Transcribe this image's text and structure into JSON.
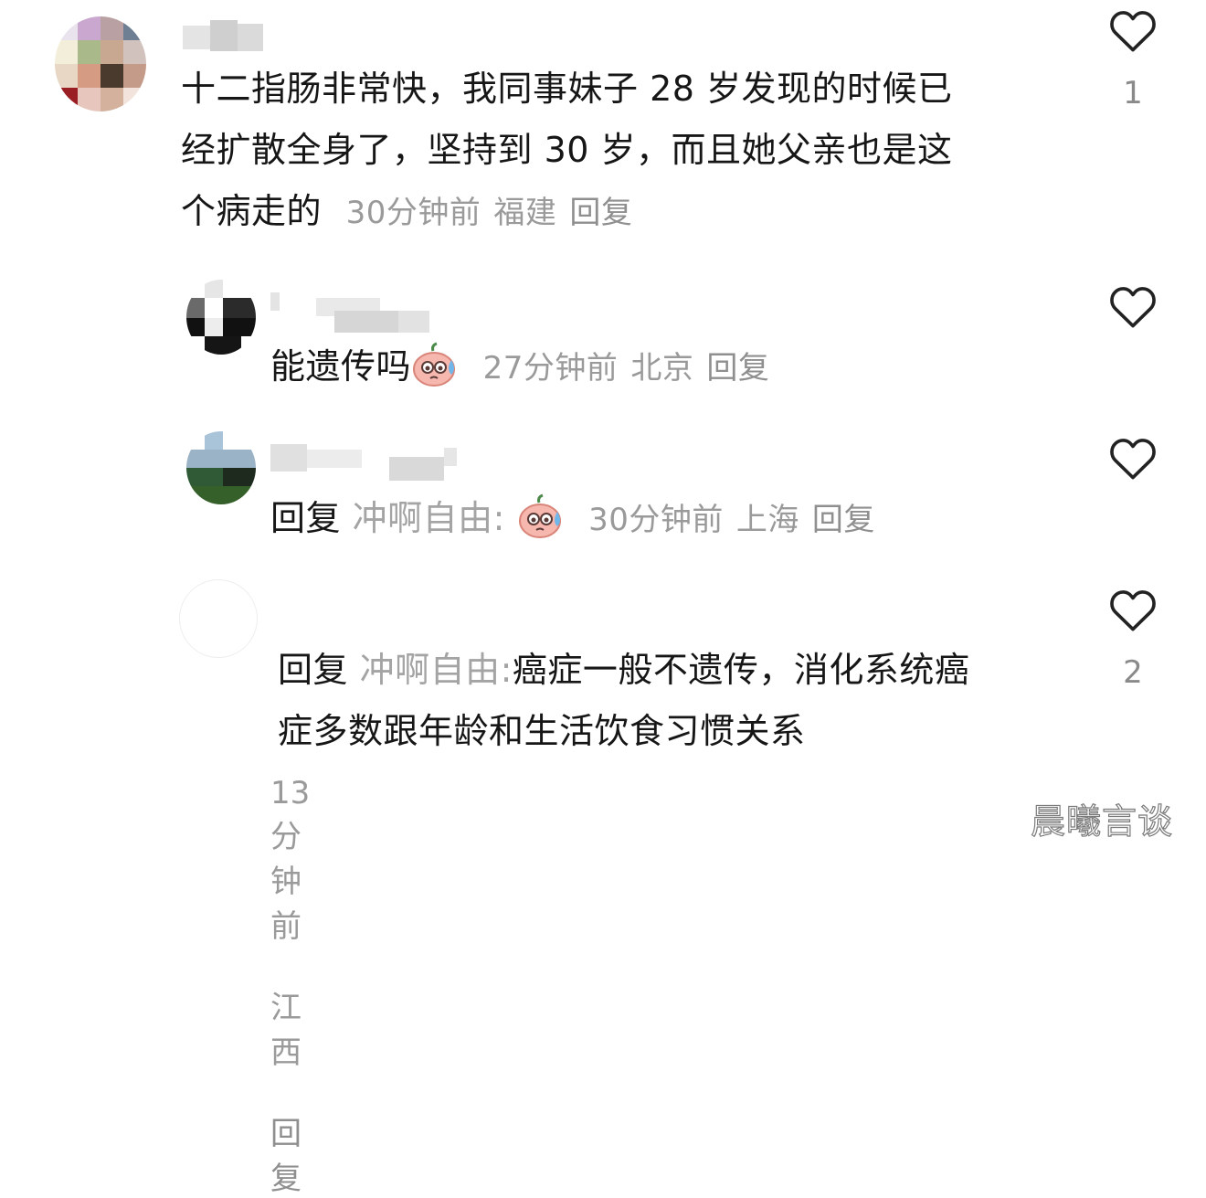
{
  "comments": [
    {
      "text": "十二指肠非常快，我同事妹子28岁发现的时候已经扩散全身了，坚持到30岁，而且她父亲也是这个病走的",
      "line1": "十二指肠非常快，我同事妹子 28 岁发现的时候已",
      "line2": "经扩散全身了，坚持到 30 岁，而且她父亲也是这",
      "line3": "个病走的",
      "time": "30分钟前",
      "location": "福建",
      "reply_label": "回复",
      "likes": "1"
    },
    {
      "text": "能遗传吗",
      "emoji": "sweat-face-emoji",
      "time": "27分钟前",
      "location": "北京",
      "reply_label": "回复",
      "likes": ""
    },
    {
      "reply_prefix": "回复",
      "reply_target": "冲啊自由:",
      "emoji": "sweat-face-emoji",
      "time": "30分钟前",
      "location": "上海",
      "reply_label": "回复",
      "likes": ""
    },
    {
      "reply_prefix": "回复",
      "reply_target": "冲啊自由:",
      "line1": "癌症一般不遗传，消化系统癌",
      "line2": "症多数跟年龄和生活饮食习惯关系",
      "time": "13分钟前",
      "location": "江西",
      "reply_label": "回复",
      "likes": "2"
    }
  ],
  "watermark": "晨曦言谈",
  "colors": {
    "text": "#161616",
    "meta": "#9a9a9a",
    "heart_stroke": "#222222",
    "background": "#ffffff"
  },
  "icons": {
    "like": "heart-outline-icon",
    "emoji": "sweat-face-emoji"
  }
}
